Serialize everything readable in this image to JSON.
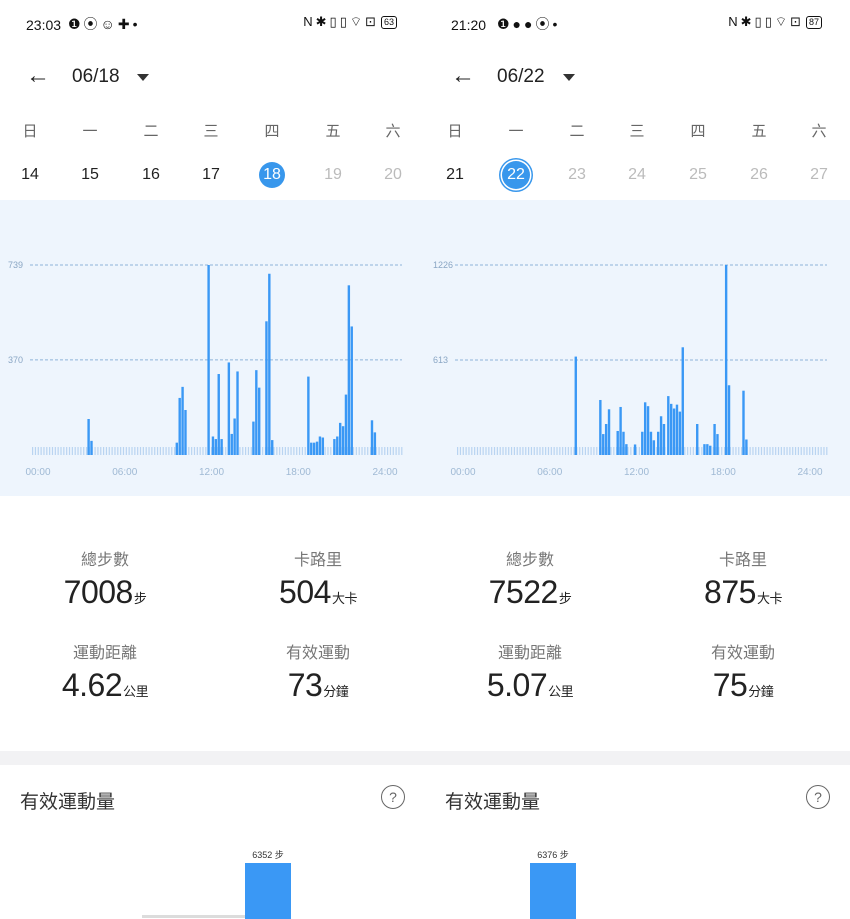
{
  "colors": {
    "accent": "#3897ec",
    "bar": "#3a98f5",
    "chart_bg": "#eef5fd",
    "guide": "#9bb8d8"
  },
  "screens": [
    {
      "status": {
        "time": "23:03",
        "notif_icons": "❶⦿☺✚•",
        "sys_icons": "N✱▯▯⌔⊡",
        "battery": "63"
      },
      "header": {
        "date": "06/18"
      },
      "weekdays": [
        "日",
        "一",
        "二",
        "三",
        "四",
        "五",
        "六"
      ],
      "dates": [
        {
          "d": "14",
          "state": "normal"
        },
        {
          "d": "15",
          "state": "normal"
        },
        {
          "d": "16",
          "state": "normal"
        },
        {
          "d": "17",
          "state": "normal"
        },
        {
          "d": "18",
          "state": "sel"
        },
        {
          "d": "19",
          "state": "muted"
        },
        {
          "d": "20",
          "state": "muted"
        }
      ],
      "stats": {
        "steps": {
          "label": "總步數",
          "value": "7008",
          "unit": "步"
        },
        "calories": {
          "label": "卡路里",
          "value": "504",
          "unit": "大卡"
        },
        "distance": {
          "label": "運動距離",
          "value": "4.62",
          "unit": "公里"
        },
        "active": {
          "label": "有效運動",
          "value": "73",
          "unit": "分鐘"
        }
      },
      "bottom": {
        "title": "有效運動量",
        "bar_label": "6352 步"
      }
    },
    {
      "status": {
        "time": "21:20",
        "notif_icons": "❶●●⦿•",
        "sys_icons": "N✱▯▯⌔⊡",
        "battery": "87"
      },
      "header": {
        "date": "06/22"
      },
      "weekdays": [
        "日",
        "一",
        "二",
        "三",
        "四",
        "五",
        "六"
      ],
      "dates": [
        {
          "d": "21",
          "state": "normal"
        },
        {
          "d": "22",
          "state": "today"
        },
        {
          "d": "23",
          "state": "muted"
        },
        {
          "d": "24",
          "state": "muted"
        },
        {
          "d": "25",
          "state": "muted"
        },
        {
          "d": "26",
          "state": "muted"
        },
        {
          "d": "27",
          "state": "muted"
        }
      ],
      "stats": {
        "steps": {
          "label": "總步數",
          "value": "7522",
          "unit": "步"
        },
        "calories": {
          "label": "卡路里",
          "value": "875",
          "unit": "大卡"
        },
        "distance": {
          "label": "運動距離",
          "value": "5.07",
          "unit": "公里"
        },
        "active": {
          "label": "有效運動",
          "value": "75",
          "unit": "分鐘"
        }
      },
      "bottom": {
        "title": "有效運動量",
        "bar_label": "6376 步"
      }
    }
  ],
  "chart_data": [
    {
      "type": "bar",
      "x_ticks": [
        "00:00",
        "06:00",
        "12:00",
        "18:00",
        "24:00"
      ],
      "x_range": [
        0,
        24
      ],
      "y_guides": [
        370,
        739
      ],
      "ylim": [
        0,
        739
      ],
      "points": [
        {
          "t": 3.5,
          "v": 140
        },
        {
          "t": 3.7,
          "v": 55
        },
        {
          "t": 9.6,
          "v": 48
        },
        {
          "t": 9.8,
          "v": 222
        },
        {
          "t": 10.0,
          "v": 265
        },
        {
          "t": 10.2,
          "v": 175
        },
        {
          "t": 11.8,
          "v": 739
        },
        {
          "t": 12.1,
          "v": 72
        },
        {
          "t": 12.3,
          "v": 62
        },
        {
          "t": 12.5,
          "v": 315
        },
        {
          "t": 12.7,
          "v": 62
        },
        {
          "t": 13.2,
          "v": 360
        },
        {
          "t": 13.4,
          "v": 82
        },
        {
          "t": 13.6,
          "v": 142
        },
        {
          "t": 13.8,
          "v": 325
        },
        {
          "t": 14.9,
          "v": 130
        },
        {
          "t": 15.1,
          "v": 330
        },
        {
          "t": 15.3,
          "v": 262
        },
        {
          "t": 15.8,
          "v": 520
        },
        {
          "t": 16.0,
          "v": 705
        },
        {
          "t": 16.2,
          "v": 58
        },
        {
          "t": 18.7,
          "v": 305
        },
        {
          "t": 18.9,
          "v": 48
        },
        {
          "t": 19.1,
          "v": 48
        },
        {
          "t": 19.3,
          "v": 52
        },
        {
          "t": 19.5,
          "v": 72
        },
        {
          "t": 19.7,
          "v": 68
        },
        {
          "t": 20.5,
          "v": 62
        },
        {
          "t": 20.7,
          "v": 72
        },
        {
          "t": 20.9,
          "v": 125
        },
        {
          "t": 21.1,
          "v": 112
        },
        {
          "t": 21.3,
          "v": 235
        },
        {
          "t": 21.5,
          "v": 660
        },
        {
          "t": 21.7,
          "v": 500
        },
        {
          "t": 23.1,
          "v": 135
        },
        {
          "t": 23.3,
          "v": 88
        }
      ]
    },
    {
      "type": "bar",
      "x_ticks": [
        "00:00",
        "06:00",
        "12:00",
        "18:00",
        "24:00"
      ],
      "x_range": [
        0,
        24
      ],
      "y_guides": [
        613,
        1226
      ],
      "ylim": [
        0,
        1226
      ],
      "points": [
        {
          "t": 7.8,
          "v": 635
        },
        {
          "t": 9.5,
          "v": 355
        },
        {
          "t": 9.7,
          "v": 135
        },
        {
          "t": 9.9,
          "v": 200
        },
        {
          "t": 10.1,
          "v": 295
        },
        {
          "t": 10.7,
          "v": 155
        },
        {
          "t": 10.9,
          "v": 310
        },
        {
          "t": 11.1,
          "v": 150
        },
        {
          "t": 11.3,
          "v": 70
        },
        {
          "t": 11.9,
          "v": 68
        },
        {
          "t": 12.4,
          "v": 150
        },
        {
          "t": 12.6,
          "v": 340
        },
        {
          "t": 12.8,
          "v": 315
        },
        {
          "t": 13.0,
          "v": 150
        },
        {
          "t": 13.2,
          "v": 95
        },
        {
          "t": 13.5,
          "v": 150
        },
        {
          "t": 13.7,
          "v": 250
        },
        {
          "t": 13.9,
          "v": 200
        },
        {
          "t": 14.2,
          "v": 380
        },
        {
          "t": 14.4,
          "v": 330
        },
        {
          "t": 14.6,
          "v": 300
        },
        {
          "t": 14.8,
          "v": 325
        },
        {
          "t": 15.0,
          "v": 280
        },
        {
          "t": 15.2,
          "v": 695
        },
        {
          "t": 16.2,
          "v": 200
        },
        {
          "t": 16.7,
          "v": 70
        },
        {
          "t": 16.9,
          "v": 70
        },
        {
          "t": 17.1,
          "v": 60
        },
        {
          "t": 17.4,
          "v": 200
        },
        {
          "t": 17.6,
          "v": 135
        },
        {
          "t": 18.2,
          "v": 1226
        },
        {
          "t": 18.4,
          "v": 450
        },
        {
          "t": 19.4,
          "v": 415
        },
        {
          "t": 19.6,
          "v": 100
        }
      ]
    }
  ]
}
